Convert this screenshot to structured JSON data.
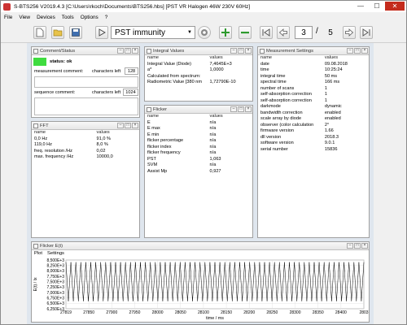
{
  "window": {
    "title": "S-BTS256 V2019.4.3 [C:\\Users\\rkoch\\Documents\\BTS256.hbs] [PST VR Halogen 46W 230V 60Hz]"
  },
  "menu": [
    "File",
    "View",
    "Devices",
    "Tools",
    "Options",
    "?"
  ],
  "toolbar": {
    "sequence": "PST immunity",
    "page_current": "3",
    "page_separator": "/",
    "page_total": "5"
  },
  "comment": {
    "title": "Comment/Status",
    "status": "status: ok",
    "measurement_label": "measurement comment:",
    "measurement_chars_label": "characters left",
    "measurement_chars": "128",
    "sequence_label": "sequence comment:",
    "sequence_chars_label": "characters left",
    "sequence_chars": "1024"
  },
  "fft": {
    "title": "FFT",
    "headers": [
      "name",
      "values"
    ],
    "rows": [
      [
        "0,0 Hz",
        "91,0 %"
      ],
      [
        "119,0 Hz",
        "8,0 %"
      ],
      [
        "freq. resolution /Hz",
        "0,02"
      ],
      [
        "max. frequency /Hz",
        "10000,0"
      ]
    ]
  },
  "integral": {
    "title": "Integral Values",
    "headers": [
      "name",
      "values"
    ],
    "rows": [
      [
        "Integral Value (Diode)",
        "7,4645E+3"
      ],
      [
        "a*",
        "1,0000"
      ],
      [
        "Calculated from spectrum:",
        ""
      ],
      [
        "Radiometric Value [380 nm",
        "1,72790E-10"
      ]
    ]
  },
  "flicker": {
    "title": "Flicker",
    "headers": [
      "name",
      "values"
    ],
    "rows": [
      [
        "E",
        "n/a"
      ],
      [
        "E max",
        "n/a"
      ],
      [
        "E min",
        "n/a"
      ],
      [
        "flicker percentage",
        "n/a"
      ],
      [
        "flicker index",
        "n/a"
      ],
      [
        "flicker frequency",
        "n/a"
      ],
      [
        "PST",
        "1,063"
      ],
      [
        "SVM",
        "n/a"
      ],
      [
        "Assist Mp",
        "0,927"
      ]
    ]
  },
  "settings": {
    "title": "Measurement Settings",
    "headers": [
      "name",
      "values"
    ],
    "rows": [
      [
        "date",
        "09.08.2018"
      ],
      [
        "time",
        "10:25:24"
      ],
      [
        "integral time",
        "50 ms"
      ],
      [
        "spectral time",
        "166 ms"
      ],
      [
        "number of scans",
        "1"
      ],
      [
        "self-absorption correction",
        "1"
      ],
      [
        "self-absorption correction",
        "1"
      ],
      [
        "darkmode",
        "dynamic"
      ],
      [
        "bandwidth correction",
        "enabled"
      ],
      [
        "scale array by diode",
        "enabled"
      ],
      [
        "observer (color calculation",
        "2°"
      ],
      [
        "firmware version",
        "1.66"
      ],
      [
        "dll version",
        "2018.3"
      ],
      [
        "software version",
        "9.0.1"
      ],
      [
        "serial number",
        "15836"
      ]
    ]
  },
  "flicker_et": {
    "title": "Flicker E(t)",
    "menu": [
      "Plot",
      "Settings"
    ]
  },
  "chart_data": {
    "type": "line",
    "xlabel": "time / ms",
    "ylabel": "E(t) / lx",
    "xlim": [
      27819,
      28031
    ],
    "ylim": [
      6250,
      8500
    ],
    "x_ticks": [
      27819,
      27850,
      27900,
      27950,
      28000,
      28050,
      28100,
      28150,
      28200,
      28250,
      28300,
      28350,
      28400,
      28450
    ],
    "x_tick_labels": [
      "27819",
      "27850",
      "27900",
      "27950",
      "28000",
      "28050",
      "28100",
      "28150",
      "28200",
      "28250",
      "28300",
      "28350",
      "28400",
      "2803"
    ],
    "y_ticks": [
      6250,
      6500,
      6750,
      7000,
      7250,
      7500,
      7750,
      8000,
      8250,
      8500
    ],
    "y_tick_labels": [
      "6,250E+3",
      "6,500E+3",
      "6,750E+3",
      "7,000E+3",
      "7,250E+3",
      "7,500E+3",
      "7,750E+3",
      "8,000E+3",
      "8,250E+3",
      "8,500E+3"
    ],
    "series": [
      {
        "min": 6600,
        "max": 8400,
        "cycles": 60
      }
    ],
    "grid": true
  },
  "colors": {
    "status_ok": "#3fdc3f",
    "accent": "#2f6fbf",
    "line": "#000000"
  }
}
